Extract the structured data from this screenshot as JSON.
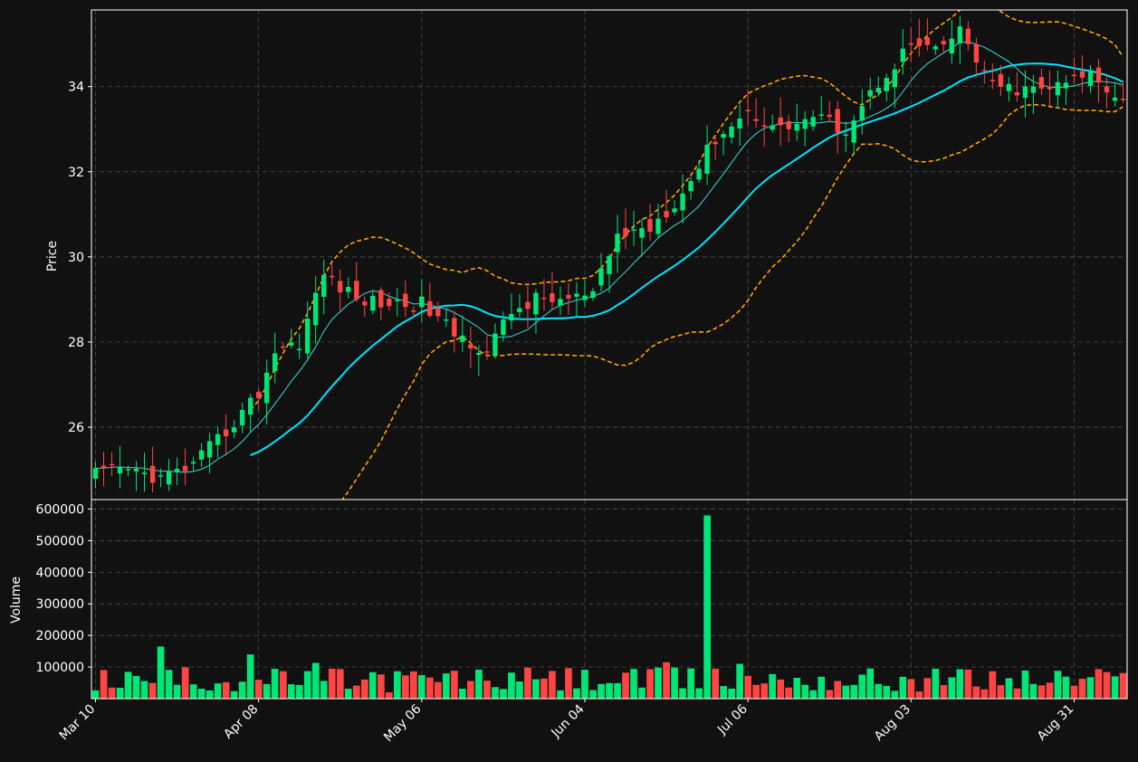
{
  "chart_data": {
    "type": "candlestick",
    "x_tick_labels": [
      "Mar 10",
      "Apr 08",
      "May 06",
      "Jun 04",
      "Jul 06",
      "Aug 03",
      "Aug 31"
    ],
    "x_tick_bar_index": [
      0,
      20,
      40,
      60,
      80,
      100,
      120
    ],
    "price_panel": {
      "ylabel": "Price",
      "ylim": [
        24.3,
        35.8
      ],
      "yticks": [
        26,
        28,
        30,
        32,
        34
      ],
      "grid": true,
      "overlays": [
        "moving-average-short (thin cyan)",
        "moving-average-long (thick cyan)",
        "bollinger-upper (dashed orange)",
        "bollinger-lower (dashed orange)"
      ]
    },
    "volume_panel": {
      "ylabel": "Volume",
      "ylim": [
        0,
        630000
      ],
      "yticks": [
        100000,
        200000,
        300000,
        400000,
        500000,
        600000
      ],
      "tick_labels": [
        "100000",
        "200000",
        "300000",
        "400000",
        "500000",
        "600000"
      ],
      "grid": true
    },
    "colors": {
      "up": "#00e676",
      "down": "#ff4444",
      "ma_short": "#40d8d8",
      "ma_long": "#00e5ff",
      "bands": "#ffa500",
      "background": "#111111",
      "grid": "#555555"
    },
    "n_bars": 127,
    "close_anchors": [
      [
        0,
        24.9
      ],
      [
        4,
        25.0
      ],
      [
        8,
        24.8
      ],
      [
        12,
        25.1
      ],
      [
        16,
        25.9
      ],
      [
        20,
        26.8
      ],
      [
        22,
        27.8
      ],
      [
        25,
        28.0
      ],
      [
        28,
        29.6
      ],
      [
        32,
        29.0
      ],
      [
        36,
        28.9
      ],
      [
        40,
        28.9
      ],
      [
        44,
        28.2
      ],
      [
        48,
        27.8
      ],
      [
        51,
        28.7
      ],
      [
        54,
        29.0
      ],
      [
        58,
        29.0
      ],
      [
        61,
        29.1
      ],
      [
        64,
        30.5
      ],
      [
        68,
        30.7
      ],
      [
        72,
        31.5
      ],
      [
        76,
        32.8
      ],
      [
        80,
        33.4
      ],
      [
        84,
        33.0
      ],
      [
        88,
        33.3
      ],
      [
        92,
        33.0
      ],
      [
        96,
        34.1
      ],
      [
        100,
        35.0
      ],
      [
        103,
        34.8
      ],
      [
        106,
        35.3
      ],
      [
        110,
        34.0
      ],
      [
        114,
        33.9
      ],
      [
        118,
        34.0
      ],
      [
        122,
        34.3
      ],
      [
        126,
        33.7
      ]
    ],
    "ma_short_start_index": 0,
    "ma_long_start_index": 19,
    "volume_spikes": [
      [
        8,
        165000
      ],
      [
        19,
        140000
      ],
      [
        27,
        113000
      ],
      [
        70,
        115000
      ],
      [
        75,
        580000
      ],
      [
        79,
        110000
      ],
      [
        106,
        93000
      ]
    ]
  }
}
